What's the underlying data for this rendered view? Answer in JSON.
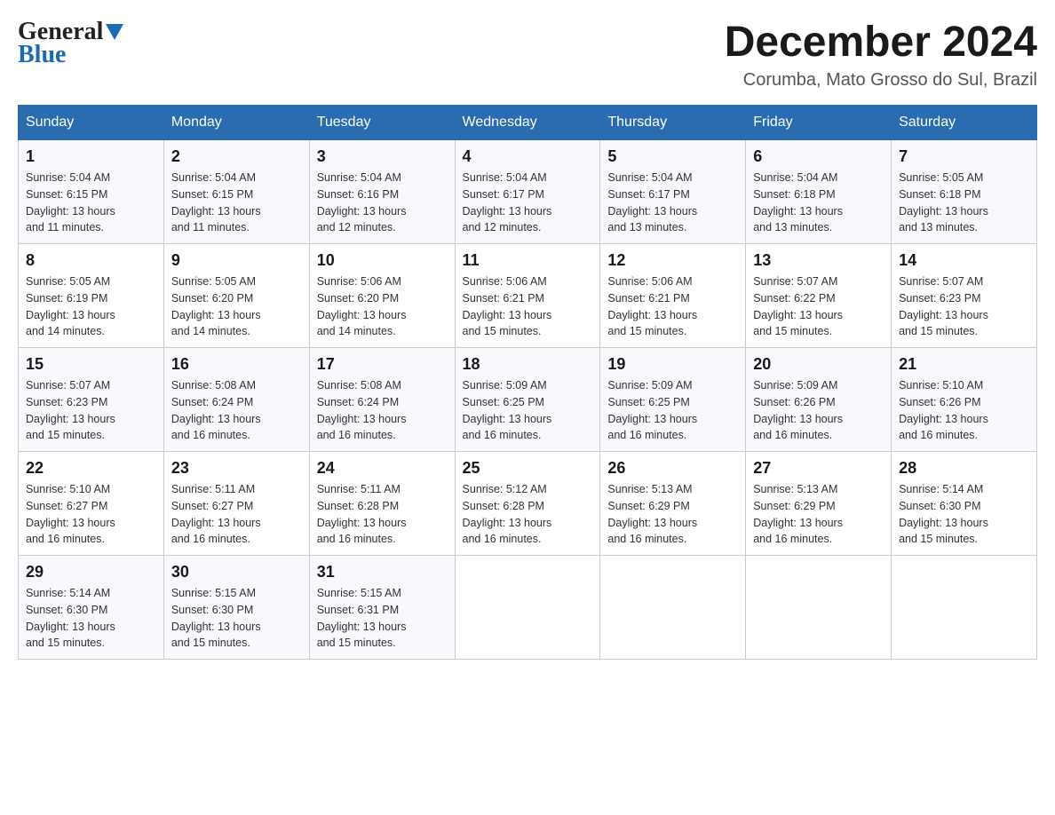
{
  "logo": {
    "general": "General",
    "blue": "Blue"
  },
  "title": "December 2024",
  "location": "Corumba, Mato Grosso do Sul, Brazil",
  "days_of_week": [
    "Sunday",
    "Monday",
    "Tuesday",
    "Wednesday",
    "Thursday",
    "Friday",
    "Saturday"
  ],
  "weeks": [
    [
      {
        "day": "1",
        "sunrise": "5:04 AM",
        "sunset": "6:15 PM",
        "daylight": "13 hours and 11 minutes."
      },
      {
        "day": "2",
        "sunrise": "5:04 AM",
        "sunset": "6:15 PM",
        "daylight": "13 hours and 11 minutes."
      },
      {
        "day": "3",
        "sunrise": "5:04 AM",
        "sunset": "6:16 PM",
        "daylight": "13 hours and 12 minutes."
      },
      {
        "day": "4",
        "sunrise": "5:04 AM",
        "sunset": "6:17 PM",
        "daylight": "13 hours and 12 minutes."
      },
      {
        "day": "5",
        "sunrise": "5:04 AM",
        "sunset": "6:17 PM",
        "daylight": "13 hours and 13 minutes."
      },
      {
        "day": "6",
        "sunrise": "5:04 AM",
        "sunset": "6:18 PM",
        "daylight": "13 hours and 13 minutes."
      },
      {
        "day": "7",
        "sunrise": "5:05 AM",
        "sunset": "6:18 PM",
        "daylight": "13 hours and 13 minutes."
      }
    ],
    [
      {
        "day": "8",
        "sunrise": "5:05 AM",
        "sunset": "6:19 PM",
        "daylight": "13 hours and 14 minutes."
      },
      {
        "day": "9",
        "sunrise": "5:05 AM",
        "sunset": "6:20 PM",
        "daylight": "13 hours and 14 minutes."
      },
      {
        "day": "10",
        "sunrise": "5:06 AM",
        "sunset": "6:20 PM",
        "daylight": "13 hours and 14 minutes."
      },
      {
        "day": "11",
        "sunrise": "5:06 AM",
        "sunset": "6:21 PM",
        "daylight": "13 hours and 15 minutes."
      },
      {
        "day": "12",
        "sunrise": "5:06 AM",
        "sunset": "6:21 PM",
        "daylight": "13 hours and 15 minutes."
      },
      {
        "day": "13",
        "sunrise": "5:07 AM",
        "sunset": "6:22 PM",
        "daylight": "13 hours and 15 minutes."
      },
      {
        "day": "14",
        "sunrise": "5:07 AM",
        "sunset": "6:23 PM",
        "daylight": "13 hours and 15 minutes."
      }
    ],
    [
      {
        "day": "15",
        "sunrise": "5:07 AM",
        "sunset": "6:23 PM",
        "daylight": "13 hours and 15 minutes."
      },
      {
        "day": "16",
        "sunrise": "5:08 AM",
        "sunset": "6:24 PM",
        "daylight": "13 hours and 16 minutes."
      },
      {
        "day": "17",
        "sunrise": "5:08 AM",
        "sunset": "6:24 PM",
        "daylight": "13 hours and 16 minutes."
      },
      {
        "day": "18",
        "sunrise": "5:09 AM",
        "sunset": "6:25 PM",
        "daylight": "13 hours and 16 minutes."
      },
      {
        "day": "19",
        "sunrise": "5:09 AM",
        "sunset": "6:25 PM",
        "daylight": "13 hours and 16 minutes."
      },
      {
        "day": "20",
        "sunrise": "5:09 AM",
        "sunset": "6:26 PM",
        "daylight": "13 hours and 16 minutes."
      },
      {
        "day": "21",
        "sunrise": "5:10 AM",
        "sunset": "6:26 PM",
        "daylight": "13 hours and 16 minutes."
      }
    ],
    [
      {
        "day": "22",
        "sunrise": "5:10 AM",
        "sunset": "6:27 PM",
        "daylight": "13 hours and 16 minutes."
      },
      {
        "day": "23",
        "sunrise": "5:11 AM",
        "sunset": "6:27 PM",
        "daylight": "13 hours and 16 minutes."
      },
      {
        "day": "24",
        "sunrise": "5:11 AM",
        "sunset": "6:28 PM",
        "daylight": "13 hours and 16 minutes."
      },
      {
        "day": "25",
        "sunrise": "5:12 AM",
        "sunset": "6:28 PM",
        "daylight": "13 hours and 16 minutes."
      },
      {
        "day": "26",
        "sunrise": "5:13 AM",
        "sunset": "6:29 PM",
        "daylight": "13 hours and 16 minutes."
      },
      {
        "day": "27",
        "sunrise": "5:13 AM",
        "sunset": "6:29 PM",
        "daylight": "13 hours and 16 minutes."
      },
      {
        "day": "28",
        "sunrise": "5:14 AM",
        "sunset": "6:30 PM",
        "daylight": "13 hours and 15 minutes."
      }
    ],
    [
      {
        "day": "29",
        "sunrise": "5:14 AM",
        "sunset": "6:30 PM",
        "daylight": "13 hours and 15 minutes."
      },
      {
        "day": "30",
        "sunrise": "5:15 AM",
        "sunset": "6:30 PM",
        "daylight": "13 hours and 15 minutes."
      },
      {
        "day": "31",
        "sunrise": "5:15 AM",
        "sunset": "6:31 PM",
        "daylight": "13 hours and 15 minutes."
      },
      null,
      null,
      null,
      null
    ]
  ],
  "labels": {
    "sunrise": "Sunrise:",
    "sunset": "Sunset:",
    "daylight": "Daylight:"
  }
}
